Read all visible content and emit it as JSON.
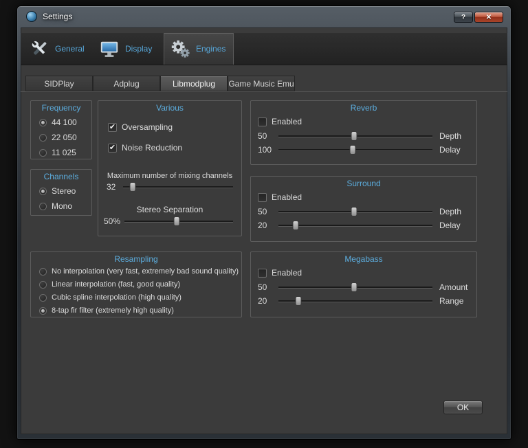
{
  "colors": {
    "accent_blue": "#57a6d8",
    "window_bg": "#3b3b3b"
  },
  "window": {
    "title": "Settings",
    "help": "?",
    "close": "✕",
    "ok": "OK"
  },
  "tabs": [
    {
      "label": "General",
      "selected": false
    },
    {
      "label": "Display",
      "selected": false
    },
    {
      "label": "Engines",
      "selected": true
    }
  ],
  "subtabs": [
    {
      "label": "SIDPlay",
      "selected": false
    },
    {
      "label": "Adplug",
      "selected": false
    },
    {
      "label": "Libmodplug",
      "selected": true
    },
    {
      "label": "Game Music Emu",
      "selected": false
    }
  ],
  "frequency": {
    "title": "Frequency",
    "options": [
      {
        "label": "44 100",
        "selected": true
      },
      {
        "label": "22 050",
        "selected": false
      },
      {
        "label": "11 025",
        "selected": false
      }
    ]
  },
  "channels": {
    "title": "Channels",
    "options": [
      {
        "label": "Stereo",
        "selected": true
      },
      {
        "label": "Mono",
        "selected": false
      }
    ]
  },
  "various": {
    "title": "Various",
    "checkboxes": [
      {
        "label": "Oversampling",
        "checked": true
      },
      {
        "label": "Noise Reduction",
        "checked": true
      }
    ],
    "mixing": {
      "label": "Maximum number of mixing channels",
      "value": "32",
      "percent": 9
    },
    "separation": {
      "label": "Stereo Separation",
      "value": "50%",
      "percent": 48
    }
  },
  "reverb": {
    "title": "Reverb",
    "enabled": {
      "label": "Enabled",
      "checked": false
    },
    "sliders": [
      {
        "value": "50",
        "label": "Depth",
        "percent": 49
      },
      {
        "value": "100",
        "label": "Delay",
        "percent": 48
      }
    ]
  },
  "surround": {
    "title": "Surround",
    "enabled": {
      "label": "Enabled",
      "checked": false
    },
    "sliders": [
      {
        "value": "50",
        "label": "Depth",
        "percent": 49
      },
      {
        "value": "20",
        "label": "Delay",
        "percent": 11
      }
    ]
  },
  "resampling": {
    "title": "Resampling",
    "options": [
      {
        "label": "No interpolation (very fast, extremely bad sound quality)",
        "selected": false
      },
      {
        "label": "Linear interpolation (fast, good quality)",
        "selected": false
      },
      {
        "label": "Cubic spline interpolation (high quality)",
        "selected": false
      },
      {
        "label": "8-tap fir filter (extremely high quality)",
        "selected": true
      }
    ]
  },
  "megabass": {
    "title": "Megabass",
    "enabled": {
      "label": "Enabled",
      "checked": false
    },
    "sliders": [
      {
        "value": "50",
        "label": "Amount",
        "percent": 49
      },
      {
        "value": "20",
        "label": "Range",
        "percent": 13
      }
    ]
  }
}
